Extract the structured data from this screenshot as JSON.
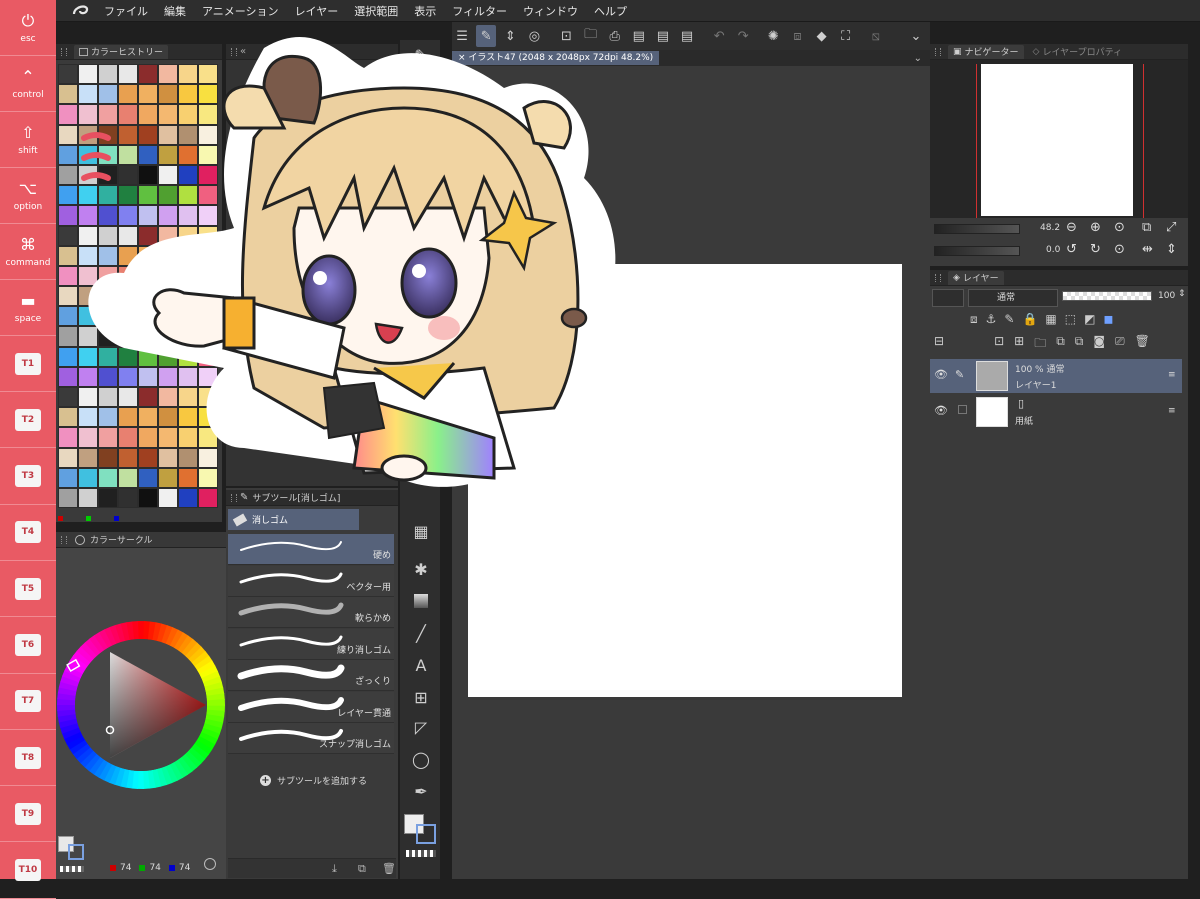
{
  "menu": [
    "ファイル",
    "編集",
    "アニメーション",
    "レイヤー",
    "選択範囲",
    "表示",
    "フィルター",
    "ウィンドウ",
    "ヘルプ"
  ],
  "keys": [
    {
      "label": "esc",
      "icon": "⏻"
    },
    {
      "label": "control",
      "icon": "⌃"
    },
    {
      "label": "shift",
      "icon": "⇧"
    },
    {
      "label": "option",
      "icon": "⌥"
    },
    {
      "label": "command",
      "icon": "⌘"
    },
    {
      "label": "space",
      "icon": "▬"
    }
  ],
  "tkeys": [
    "T1",
    "T2",
    "T3",
    "T4",
    "T5",
    "T6",
    "T7",
    "T8",
    "T9",
    "T10"
  ],
  "panels": {
    "color_history": "カラーヒストリー",
    "color_circle": "カラーサークル",
    "subtool_title": "サブツール[消しゴム]",
    "subtool_group": "消しゴム",
    "add_subtool": "サブツールを追加する",
    "navigator": "ナビゲーター",
    "layer_property": "レイヤープロパティ",
    "layer": "レイヤー"
  },
  "subtools": [
    "硬め",
    "ベクター用",
    "軟らかめ",
    "練り消しゴム",
    "ざっくり",
    "レイヤー貫通",
    "スナップ消しゴム"
  ],
  "document_tab": "イラスト47 (2048 x 2048px 72dpi 48.2%)",
  "navigator": {
    "zoom": "48.2",
    "rotation": "0.0"
  },
  "layer_controls": {
    "blend_mode": "通常",
    "opacity": "100"
  },
  "layers": [
    {
      "opacity_mode": "100 % 通常",
      "name": "レイヤー1"
    },
    {
      "opacity_mode": "",
      "name": "用紙"
    }
  ],
  "rgb_values": [
    "74",
    "74",
    "74"
  ],
  "colors": {
    "keybar": "#e95a64",
    "selection": "#56627a",
    "panel": "#3a3a3a"
  },
  "swatch_colors": [
    "#3a3a3a",
    "#f0f0f0",
    "#d0d0d0",
    "#e8e8e8",
    "#8b2c2c",
    "#f2b8a0",
    "#f7d58a",
    "#f9e08a",
    "#d8c090",
    "#c8e0f8",
    "#a0c0e8",
    "#e8a050",
    "#f0b060",
    "#d09040",
    "#f8c840",
    "#f8e040",
    "#f090c0",
    "#f0c0d0",
    "#f0a0a0",
    "#e88070",
    "#f0a860",
    "#f4b870",
    "#f8d070",
    "#f8e880",
    "#e8d8c0",
    "#c0a080",
    "#804020",
    "#c06030",
    "#a04020",
    "#e0c0a0",
    "#b09070",
    "#f8f0e0",
    "#60a0e0",
    "#40c0e0",
    "#80e0c0",
    "#c0e0a0",
    "#3060c0",
    "#c0a040",
    "#e07030",
    "#f8f8b0",
    "#a0a0a0",
    "#d0d0d0",
    "#202020",
    "#303030",
    "#101010",
    "#f0f0f0",
    "#2040c0",
    "#e02060",
    "#40a0f0",
    "#40d0f0",
    "#30b0a0",
    "#208040",
    "#60c040",
    "#50a030",
    "#b0e040",
    "#f06080",
    "#a060e0",
    "#c080f0",
    "#5050d0",
    "#8080f0",
    "#c0c0f0",
    "#d0a0f0",
    "#e0c0f0",
    "#f0d0f8"
  ]
}
